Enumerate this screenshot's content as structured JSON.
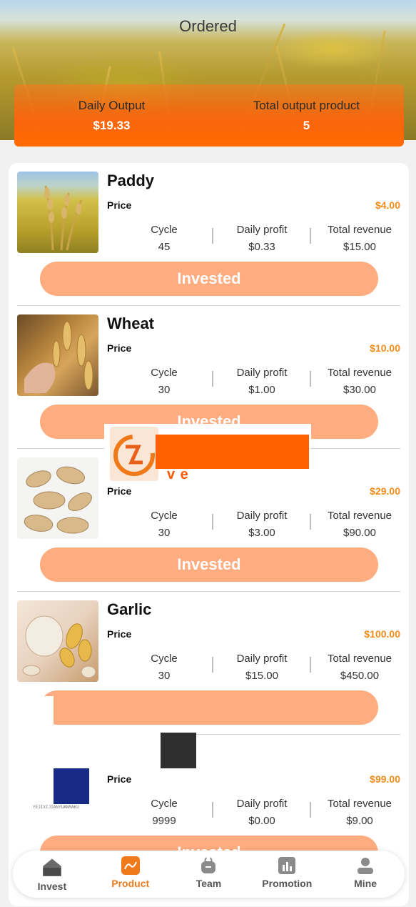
{
  "header": {
    "title": "Ordered"
  },
  "summary": {
    "daily_output_label": "Daily Output",
    "daily_output_value": "$19.33",
    "total_output_label": "Total output product",
    "total_output_value": "5"
  },
  "labels": {
    "price": "Price",
    "cycle": "Cycle",
    "daily_profit": "Daily profit",
    "total_revenue": "Total revenue"
  },
  "products": [
    {
      "name": "Paddy",
      "price": "$4.00",
      "cycle": "45",
      "daily_profit": "$0.33",
      "total_revenue": "$15.00",
      "button": "Invested"
    },
    {
      "name": "Wheat",
      "price": "$10.00",
      "cycle": "30",
      "daily_profit": "$1.00",
      "total_revenue": "$30.00",
      "button": "Invested"
    },
    {
      "name": "",
      "price": "$29.00",
      "cycle": "30",
      "daily_profit": "$3.00",
      "total_revenue": "$90.00",
      "button": "Invested"
    },
    {
      "name": "Garlic",
      "price": "$100.00",
      "cycle": "30",
      "daily_profit": "$15.00",
      "total_revenue": "$450.00",
      "button": ""
    },
    {
      "name": "",
      "price": "$99.00",
      "cycle": "9999",
      "daily_profit": "$0.00",
      "total_revenue": "$9.00",
      "button": "Invested"
    }
  ],
  "overlay": {
    "logo_text": "v          e",
    "tiny_text": "YEJIXIJIANYUANMAKU"
  },
  "nav": {
    "items": [
      {
        "label": "Invest",
        "icon": "house-icon"
      },
      {
        "label": "Product",
        "icon": "chart-icon"
      },
      {
        "label": "Team",
        "icon": "team-icon"
      },
      {
        "label": "Promotion",
        "icon": "bar-chart-icon"
      },
      {
        "label": "Mine",
        "icon": "user-icon"
      }
    ],
    "active": "Product"
  },
  "colors": {
    "accent": "#f07a1a",
    "button": "#ffac80",
    "summary_orange": "#ff6a00"
  }
}
